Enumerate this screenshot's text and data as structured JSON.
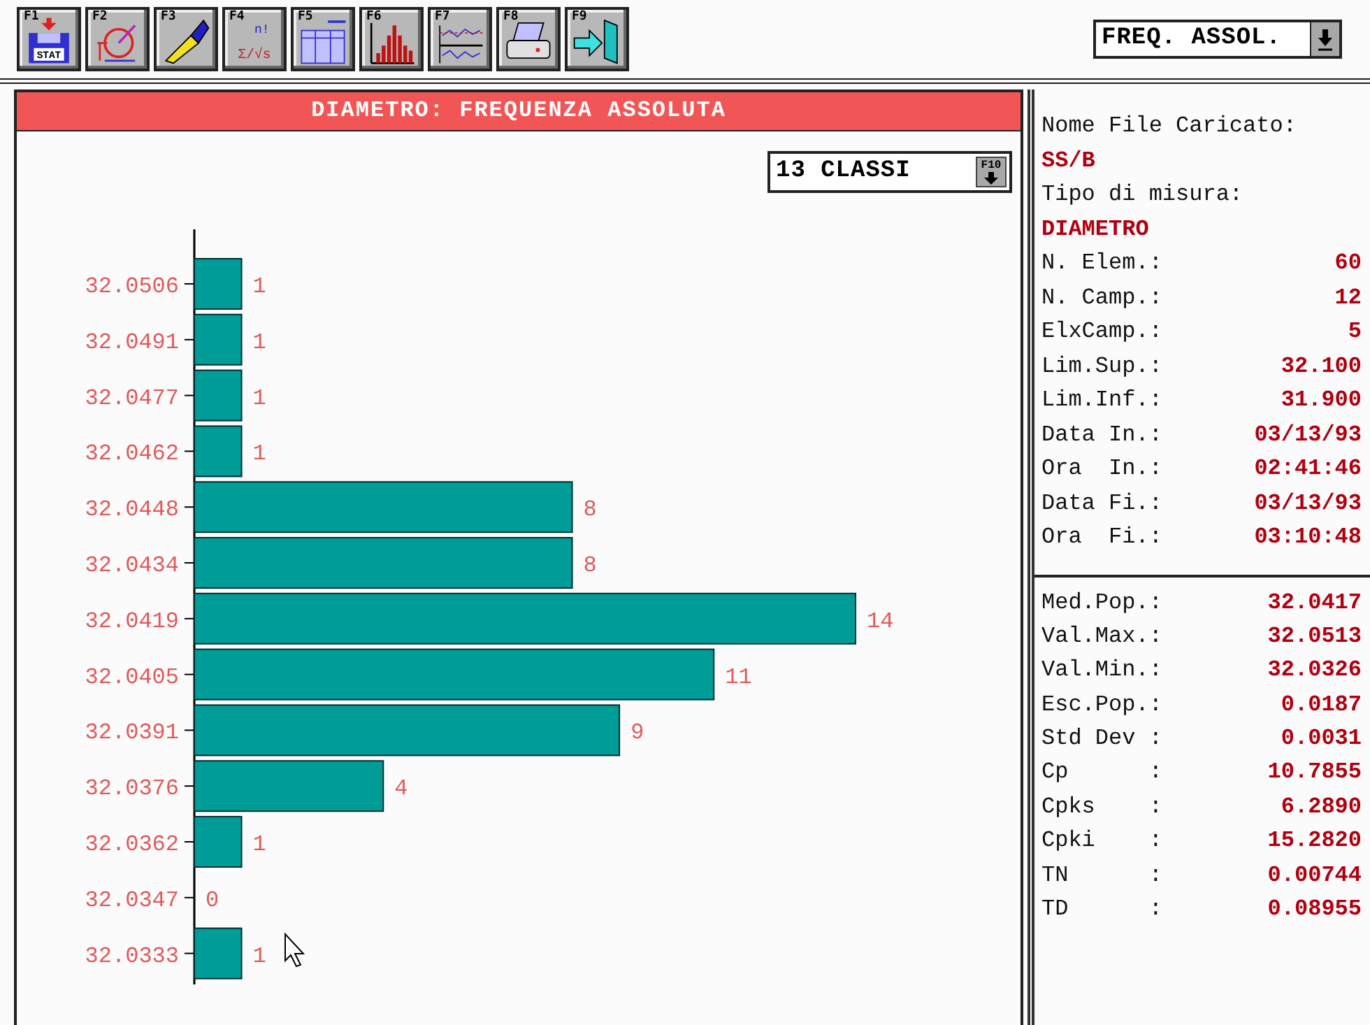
{
  "toolbar": [
    {
      "key": "F1",
      "kind": "disk",
      "texts": [
        "STAT"
      ]
    },
    {
      "key": "F2",
      "kind": "measure"
    },
    {
      "key": "F3",
      "kind": "pen"
    },
    {
      "key": "F4",
      "kind": "formula",
      "texts": [
        "n!",
        "Σ/√s"
      ]
    },
    {
      "key": "F5",
      "kind": "table"
    },
    {
      "key": "F6",
      "kind": "histogram"
    },
    {
      "key": "F7",
      "kind": "control"
    },
    {
      "key": "F8",
      "kind": "printer"
    },
    {
      "key": "F9",
      "kind": "exit"
    }
  ],
  "view_select": {
    "value": "FREQ. ASSOL."
  },
  "chart_panel": {
    "title": "DIAMETRO: FREQUENZA ASSOLUTA",
    "classes_select": {
      "value": "13 CLASSI",
      "key": "F10"
    },
    "chart_data": {
      "type": "bar",
      "orientation": "horizontal",
      "data_labels": true,
      "categories": [
        "32.0506",
        "32.0491",
        "32.0477",
        "32.0462",
        "32.0448",
        "32.0434",
        "32.0419",
        "32.0405",
        "32.0391",
        "32.0376",
        "32.0362",
        "32.0347",
        "32.0333"
      ],
      "values": [
        1,
        1,
        1,
        1,
        8,
        8,
        14,
        11,
        9,
        4,
        1,
        0,
        1
      ]
    }
  },
  "info": [
    {
      "kind": "heading",
      "text": "Nome File Caricato:"
    },
    {
      "kind": "value",
      "text": "SS/B"
    },
    {
      "kind": "heading",
      "text": "Tipo di misura:"
    },
    {
      "kind": "value",
      "text": "DIAMETRO"
    },
    {
      "kind": "pair",
      "label": "N. Elem.:",
      "value": "60"
    },
    {
      "kind": "pair",
      "label": "N. Camp.:",
      "value": "12"
    },
    {
      "kind": "pair",
      "label": "ElxCamp.:",
      "value": "5"
    },
    {
      "kind": "pair",
      "label": "Lim.Sup.:",
      "value": "32.100"
    },
    {
      "kind": "pair",
      "label": "Lim.Inf.:",
      "value": "31.900"
    },
    {
      "kind": "pair",
      "label": "Data In.:",
      "value": "03/13/93"
    },
    {
      "kind": "pair",
      "label": "Ora  In.:",
      "value": "02:41:46"
    },
    {
      "kind": "pair",
      "label": "Data Fi.:",
      "value": "03/13/93"
    },
    {
      "kind": "pair",
      "label": "Ora  Fi.:",
      "value": "03:10:48"
    }
  ],
  "stats": [
    {
      "label": "Med.Pop.:",
      "value": "32.0417"
    },
    {
      "label": "Val.Max.:",
      "value": "32.0513"
    },
    {
      "label": "Val.Min.:",
      "value": "32.0326"
    },
    {
      "label": "Esc.Pop.:",
      "value": "0.0187"
    },
    {
      "label": "Std Dev :",
      "value": "0.0031"
    },
    {
      "label": "Cp      :",
      "value": "10.7855"
    },
    {
      "label": "Cpks    :",
      "value": "6.2890"
    },
    {
      "label": "Cpki    :",
      "value": "15.2820"
    },
    {
      "label": "TN      :",
      "value": "0.00744"
    },
    {
      "label": "TD      :",
      "value": "0.08955"
    }
  ]
}
